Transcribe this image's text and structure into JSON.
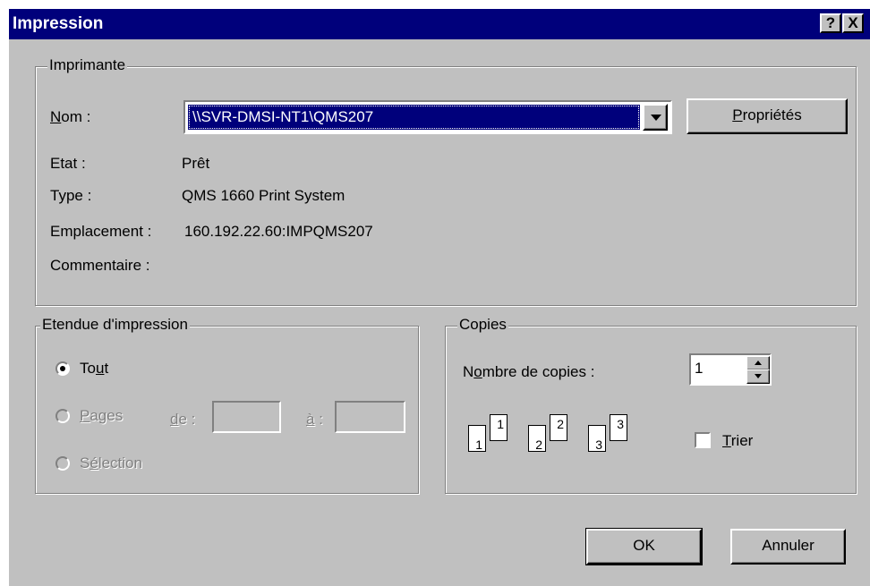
{
  "window": {
    "title": "Impression",
    "help_button": "?",
    "close_button": "X"
  },
  "printer": {
    "group_label": "Imprimante",
    "name_label": "Nom :",
    "name_value": "\\\\SVR-DMSI-NT1\\QMS207",
    "properties_button": "Propriétés",
    "status_label": "Etat :",
    "status_value": "Prêt",
    "type_label": "Type :",
    "type_value": "QMS 1660 Print System",
    "location_label": "Emplacement :",
    "location_value": "160.192.22.60:IMPQMS207",
    "comment_label": "Commentaire :",
    "comment_value": ""
  },
  "range": {
    "group_label": "Etendue d'impression",
    "all_label": "Tout",
    "pages_label": "Pages",
    "from_label": "de :",
    "from_value": "",
    "to_label": "à :",
    "to_value": "",
    "selection_label": "Sélection",
    "selected": "all"
  },
  "copies": {
    "group_label": "Copies",
    "count_label": "Nombre de copies :",
    "count_value": "1",
    "collate_label": "Trier",
    "collate_checked": false,
    "collate_pages": [
      "1",
      "1",
      "2",
      "2",
      "3",
      "3"
    ]
  },
  "buttons": {
    "ok": "OK",
    "cancel": "Annuler"
  }
}
